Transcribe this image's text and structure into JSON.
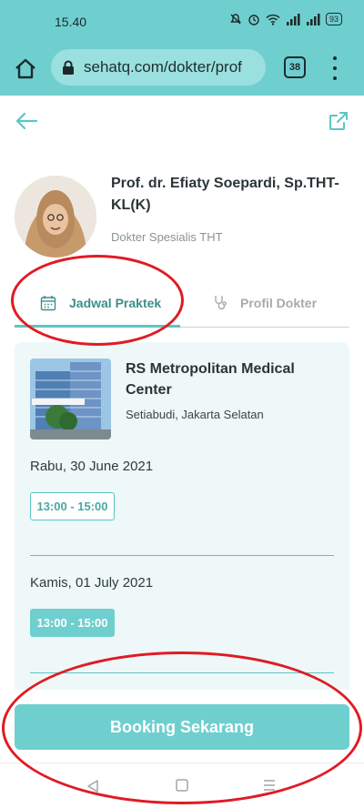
{
  "status_bar": {
    "time": "15.40",
    "battery": "93"
  },
  "browser": {
    "url": "sehatq.com/dokter/prof",
    "tab_count": "38"
  },
  "doctor": {
    "name": "Prof. dr. Efiaty Soepardi, Sp.THT-KL(K)",
    "specialty": "Dokter Spesialis THT"
  },
  "tabs": [
    {
      "label": "Jadwal Praktek",
      "active": true
    },
    {
      "label": "Profil Dokter",
      "active": false
    }
  ],
  "hospital": {
    "name": "RS Metropolitan Medical Center",
    "location": "Setiabudi, Jakarta Selatan"
  },
  "schedules": [
    {
      "date": "Rabu, 30 June 2021",
      "slot": "13:00 - 15:00",
      "selected": false
    },
    {
      "date": "Kamis, 01 July 2021",
      "slot": "13:00 - 15:00",
      "selected": true
    }
  ],
  "booking_button": "Booking Sekarang",
  "colors": {
    "accent": "#6fcfcf",
    "accent_dark": "#3d8e88",
    "annotation": "#e01b24"
  }
}
